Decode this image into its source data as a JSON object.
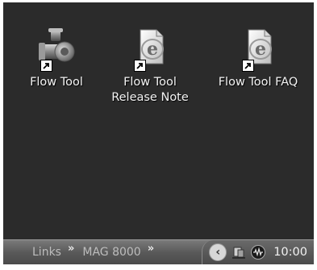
{
  "desktop": {
    "icons": [
      {
        "label": "Flow Tool",
        "icon": "flow-meter-icon"
      },
      {
        "label": "Flow Tool\nRelease Note",
        "icon": "internet-document-icon"
      },
      {
        "label": "Flow Tool FAQ",
        "icon": "internet-document-icon"
      }
    ]
  },
  "taskbar": {
    "toolbars": [
      {
        "label": "Links",
        "chevron": "»"
      },
      {
        "label": "MAG 8000",
        "chevron": "»"
      }
    ],
    "tray": {
      "expand_button": "‹",
      "icons": [
        "network-icon",
        "audio-wave-icon"
      ],
      "clock": "10:00"
    }
  },
  "colors": {
    "desktop_background": "#2b2b2b",
    "taskbar_background": "#5a5a5a",
    "icon_text": "#f3f3f3"
  }
}
